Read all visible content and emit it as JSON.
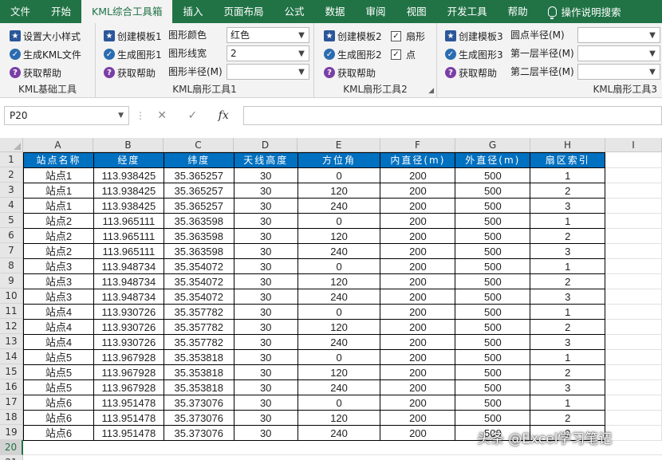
{
  "menu": {
    "tabs": [
      "文件",
      "开始",
      "KML综合工具箱",
      "插入",
      "页面布局",
      "公式",
      "数据",
      "审阅",
      "视图",
      "开发工具",
      "帮助"
    ],
    "active": "KML综合工具箱",
    "help": "操作说明搜索"
  },
  "ribbon": {
    "g1": {
      "set_size": "设置大小样式",
      "gen_kml": "生成KML文件",
      "help": "获取帮助",
      "label": "KML基础工具"
    },
    "g2": {
      "create": "创建模板1",
      "gen": "生成图形1",
      "help": "获取帮助",
      "color_label": "图形颜色",
      "color_value": "红色",
      "width_label": "图形线宽",
      "width_value": "2",
      "radius_label": "图形半径(M)",
      "radius_value": "",
      "label": "KML扇形工具1"
    },
    "g3": {
      "create": "创建模板2",
      "gen": "生成图形2",
      "help": "获取帮助",
      "sector_label": "扇形",
      "point_label": "点",
      "label": "KML扇形工具2"
    },
    "g4": {
      "create": "创建模板3",
      "gen": "生成图形3",
      "help": "获取帮助",
      "r0_label": "圆点半径(M)",
      "r1_label": "第一层半径(M)",
      "r2_label": "第二层半径(M)",
      "label": "KML扇形工具3"
    }
  },
  "formula_bar": {
    "name_box": "P20",
    "formula": ""
  },
  "grid": {
    "columns": [
      "A",
      "B",
      "C",
      "D",
      "E",
      "F",
      "G",
      "H",
      "I"
    ],
    "row_numbers": [
      "1",
      "2",
      "3",
      "4",
      "5",
      "6",
      "7",
      "8",
      "9",
      "10",
      "11",
      "12",
      "13",
      "14",
      "15",
      "16",
      "17",
      "18",
      "19",
      "20",
      "21"
    ],
    "selected_row": "20",
    "headers": [
      "站点名称",
      "经度",
      "纬度",
      "天线高度",
      "方位角",
      "内直径(m)",
      "外直径(m)",
      "扇区索引"
    ],
    "rows": [
      [
        "站点1",
        "113.938425",
        "35.365257",
        "30",
        "0",
        "200",
        "500",
        "1"
      ],
      [
        "站点1",
        "113.938425",
        "35.365257",
        "30",
        "120",
        "200",
        "500",
        "2"
      ],
      [
        "站点1",
        "113.938425",
        "35.365257",
        "30",
        "240",
        "200",
        "500",
        "3"
      ],
      [
        "站点2",
        "113.965111",
        "35.363598",
        "30",
        "0",
        "200",
        "500",
        "1"
      ],
      [
        "站点2",
        "113.965111",
        "35.363598",
        "30",
        "120",
        "200",
        "500",
        "2"
      ],
      [
        "站点2",
        "113.965111",
        "35.363598",
        "30",
        "240",
        "200",
        "500",
        "3"
      ],
      [
        "站点3",
        "113.948734",
        "35.354072",
        "30",
        "0",
        "200",
        "500",
        "1"
      ],
      [
        "站点3",
        "113.948734",
        "35.354072",
        "30",
        "120",
        "200",
        "500",
        "2"
      ],
      [
        "站点3",
        "113.948734",
        "35.354072",
        "30",
        "240",
        "200",
        "500",
        "3"
      ],
      [
        "站点4",
        "113.930726",
        "35.357782",
        "30",
        "0",
        "200",
        "500",
        "1"
      ],
      [
        "站点4",
        "113.930726",
        "35.357782",
        "30",
        "120",
        "200",
        "500",
        "2"
      ],
      [
        "站点4",
        "113.930726",
        "35.357782",
        "30",
        "240",
        "200",
        "500",
        "3"
      ],
      [
        "站点5",
        "113.967928",
        "35.353818",
        "30",
        "0",
        "200",
        "500",
        "1"
      ],
      [
        "站点5",
        "113.967928",
        "35.353818",
        "30",
        "120",
        "200",
        "500",
        "2"
      ],
      [
        "站点5",
        "113.967928",
        "35.353818",
        "30",
        "240",
        "200",
        "500",
        "3"
      ],
      [
        "站点6",
        "113.951478",
        "35.373076",
        "30",
        "0",
        "200",
        "500",
        "1"
      ],
      [
        "站点6",
        "113.951478",
        "35.373076",
        "30",
        "120",
        "200",
        "500",
        "2"
      ],
      [
        "站点6",
        "113.951478",
        "35.373076",
        "30",
        "240",
        "200",
        "500",
        "3"
      ]
    ]
  },
  "watermark": "头条 @Excel学习笔记",
  "colors": {
    "excel_green": "#217346",
    "header_blue": "#0070c0"
  }
}
